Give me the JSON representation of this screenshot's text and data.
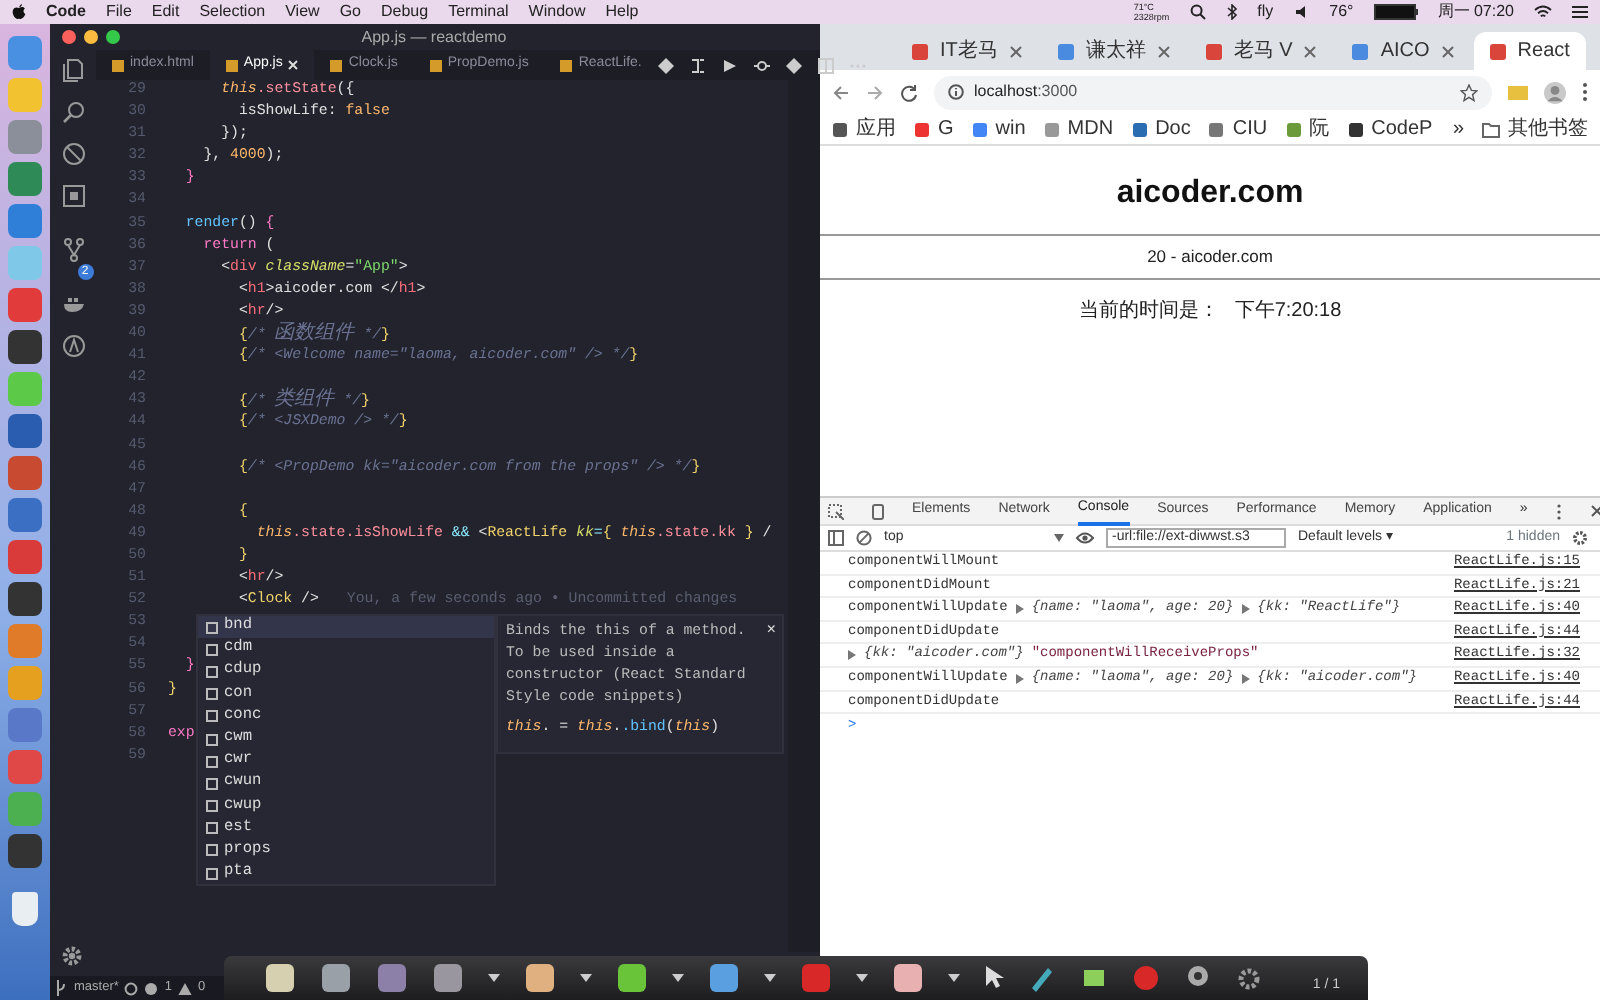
{
  "menubar": {
    "app": "Code",
    "items": [
      "File",
      "Edit",
      "Selection",
      "View",
      "Go",
      "Debug",
      "Terminal",
      "Window",
      "Help"
    ],
    "temp": "71°C",
    "fan": "2328rpm",
    "fly": "fly",
    "weather": "76°",
    "clock": "周一 07:20"
  },
  "editor": {
    "title": "App.js — reactdemo",
    "tabs": [
      {
        "label": "index.html",
        "selected": false
      },
      {
        "label": "App.js",
        "selected": true
      },
      {
        "label": "Clock.js",
        "selected": false
      },
      {
        "label": "PropDemo.js",
        "selected": false
      },
      {
        "label": "ReactLife.",
        "selected": false
      }
    ],
    "scm_badge": "2",
    "lines": [
      {
        "n": "29",
        "code": [
          {
            "kind": "this",
            "text": "      this"
          },
          {
            "kind": "prop",
            "text": ".setState"
          },
          {
            "kind": "pl",
            "text": "({"
          }
        ]
      },
      {
        "n": "30",
        "code": [
          {
            "kind": "pl",
            "text": "        isShowLife: "
          },
          {
            "kind": "num",
            "text": "false"
          }
        ]
      },
      {
        "n": "31",
        "code": [
          {
            "kind": "pl",
            "text": "      });"
          }
        ]
      },
      {
        "n": "32",
        "code": [
          {
            "kind": "pl",
            "text": "    }, "
          },
          {
            "kind": "num",
            "text": "4000"
          },
          {
            "kind": "pl",
            "text": ");"
          }
        ]
      },
      {
        "n": "33",
        "code": [
          {
            "kind": "kw",
            "text": "  }"
          }
        ]
      },
      {
        "n": "34"
      },
      {
        "n": "35",
        "code": [
          {
            "kind": "fn",
            "text": "  render"
          },
          {
            "kind": "pl",
            "text": "() "
          },
          {
            "kind": "kw",
            "text": "{"
          }
        ]
      },
      {
        "n": "36",
        "code": [
          {
            "kind": "kw",
            "text": "    return"
          },
          {
            "kind": "pl",
            "text": " ("
          }
        ]
      },
      {
        "n": "37",
        "code": [
          {
            "kind": "pl",
            "text": "      <"
          },
          {
            "kind": "tag",
            "text": "div"
          },
          {
            "kind": "attr",
            "text": " className"
          },
          {
            "kind": "pl",
            "text": "="
          },
          {
            "kind": "str",
            "text": "\"App\""
          },
          {
            "kind": "pl",
            "text": ">"
          }
        ]
      },
      {
        "n": "38",
        "code": [
          {
            "kind": "pl",
            "text": "        <"
          },
          {
            "kind": "tag",
            "text": "h1"
          },
          {
            "kind": "pl",
            "text": ">aicoder.com </"
          },
          {
            "kind": "tag",
            "text": "h1"
          },
          {
            "kind": "pl",
            "text": ">"
          }
        ]
      },
      {
        "n": "39",
        "code": [
          {
            "kind": "pl",
            "text": "        <"
          },
          {
            "kind": "tag",
            "text": "hr"
          },
          {
            "kind": "pl",
            "text": "/>"
          }
        ]
      },
      {
        "n": "40",
        "code": [
          {
            "kind": "brace",
            "text": "        {"
          },
          {
            "kind": "cmt",
            "text": "/* "
          },
          {
            "kind": "cmtcjk",
            "text": "函数组件"
          },
          {
            "kind": "cmt",
            "text": " */"
          },
          {
            "kind": "brace",
            "text": "}"
          }
        ]
      },
      {
        "n": "41",
        "code": [
          {
            "kind": "brace",
            "text": "        {"
          },
          {
            "kind": "cmt",
            "text": "/* <Welcome name=\"laoma, aicoder.com\" /> */"
          },
          {
            "kind": "brace",
            "text": "}"
          }
        ]
      },
      {
        "n": "42"
      },
      {
        "n": "43",
        "code": [
          {
            "kind": "brace",
            "text": "        {"
          },
          {
            "kind": "cmt",
            "text": "/* "
          },
          {
            "kind": "cmtcjk",
            "text": "类组件"
          },
          {
            "kind": "cmt",
            "text": " */"
          },
          {
            "kind": "brace",
            "text": "}"
          }
        ]
      },
      {
        "n": "44",
        "code": [
          {
            "kind": "brace",
            "text": "        {"
          },
          {
            "kind": "cmt",
            "text": "/* <JSXDemo /> */"
          },
          {
            "kind": "brace",
            "text": "}"
          }
        ]
      },
      {
        "n": "45"
      },
      {
        "n": "46",
        "code": [
          {
            "kind": "brace",
            "text": "        {"
          },
          {
            "kind": "cmt",
            "text": "/* <PropDemo kk=\"aicoder.com from the props\" /> */"
          },
          {
            "kind": "brace",
            "text": "}"
          }
        ]
      },
      {
        "n": "47"
      },
      {
        "n": "48",
        "code": [
          {
            "kind": "brace",
            "text": "        {"
          }
        ]
      },
      {
        "n": "49",
        "code": [
          {
            "kind": "this",
            "text": "          this"
          },
          {
            "kind": "prop",
            "text": ".state.isShowLife"
          },
          {
            "kind": "op",
            "text": " && "
          },
          {
            "kind": "pl",
            "text": "<"
          },
          {
            "kind": "comp",
            "text": "ReactLife"
          },
          {
            "kind": "attr",
            "text": " kk"
          },
          {
            "kind": "op",
            "text": "="
          },
          {
            "kind": "brace",
            "text": "{"
          },
          {
            "kind": "this",
            "text": " this"
          },
          {
            "kind": "prop",
            "text": ".state.kk"
          },
          {
            "kind": "brace",
            "text": " }"
          },
          {
            "kind": "pl",
            "text": " /"
          }
        ]
      },
      {
        "n": "50",
        "code": [
          {
            "kind": "brace",
            "text": "        }"
          }
        ]
      },
      {
        "n": "51",
        "code": [
          {
            "kind": "pl",
            "text": "        <"
          },
          {
            "kind": "tag",
            "text": "hr"
          },
          {
            "kind": "pl",
            "text": "/>"
          }
        ]
      },
      {
        "n": "52",
        "code": [
          {
            "kind": "pl",
            "text": "        <"
          },
          {
            "kind": "comp",
            "text": "Clock"
          },
          {
            "kind": "pl",
            "text": " />"
          }
        ],
        "blame": "You, a few seconds ago • Uncommitted changes"
      },
      {
        "n": "53"
      },
      {
        "n": "54"
      },
      {
        "n": "55",
        "code": [
          {
            "kind": "kw",
            "text": "  }"
          }
        ]
      },
      {
        "n": "56",
        "code": [
          {
            "kind": "brace",
            "text": "}"
          }
        ]
      },
      {
        "n": "57"
      },
      {
        "n": "58",
        "code": [
          {
            "kind": "kw",
            "text": "exp"
          }
        ]
      },
      {
        "n": "59"
      }
    ],
    "suggest": [
      {
        "label": "bnd",
        "selected": true
      },
      {
        "label": "cdm",
        "selected": false
      },
      {
        "label": "cdup",
        "selected": false
      },
      {
        "label": "con",
        "selected": false
      },
      {
        "label": "conc",
        "selected": false
      },
      {
        "label": "cwm",
        "selected": false
      },
      {
        "label": "cwr",
        "selected": false
      },
      {
        "label": "cwun",
        "selected": false
      },
      {
        "label": "cwup",
        "selected": false
      },
      {
        "label": "est",
        "selected": false
      },
      {
        "label": "props",
        "selected": false
      },
      {
        "label": "pta",
        "selected": false
      }
    ],
    "doc": {
      "text": "Binds the this of a method. To be used inside a constructor (React Standard Style code snippets)",
      "close": "×",
      "code": [
        {
          "kind": "this",
          "text": "this"
        },
        {
          "kind": "pl",
          "text": ". = "
        },
        {
          "kind": "this",
          "text": "this"
        },
        {
          "kind": "pl",
          "text": "."
        },
        {
          "kind": "fn",
          "text": ".bind"
        },
        {
          "kind": "pl",
          "text": "("
        },
        {
          "kind": "this",
          "text": "this"
        },
        {
          "kind": "pl",
          "text": ")"
        }
      ]
    },
    "status": {
      "branch": "master*",
      "errors": "1",
      "warnings": "0"
    }
  },
  "recorder": {
    "page": "1 / 1"
  },
  "browser": {
    "tabs": [
      {
        "label": "IT老马",
        "selected": false
      },
      {
        "label": "谦太祥",
        "selected": false
      },
      {
        "label": "老马 V",
        "selected": false
      },
      {
        "label": "AICO",
        "selected": false
      },
      {
        "label": "React",
        "selected": true
      }
    ],
    "url": "**localhost**:3000",
    "bookmarks": [
      "应用",
      "G",
      "win",
      "MDN",
      "Doc",
      "CIU",
      "阮",
      "CodeP"
    ],
    "bookmarks_more": "»",
    "other_bookmarks": "其他书签",
    "page": {
      "heading": "aicoder.com",
      "props": "20 - aicoder.com",
      "time_label": "当前的时间是：",
      "time": "下午7:20:18"
    }
  },
  "devtools": {
    "tabs": [
      {
        "label": "Elements",
        "selected": false
      },
      {
        "label": "Network",
        "selected": false
      },
      {
        "label": "Console",
        "selected": true
      },
      {
        "label": "Sources",
        "selected": false
      },
      {
        "label": "Performance",
        "selected": false
      },
      {
        "label": "Memory",
        "selected": false
      },
      {
        "label": "Application",
        "selected": false
      }
    ],
    "more": "»",
    "context": "top",
    "filter": "-url:file://ext-diwwst.s3",
    "levels": "Default levels ▾",
    "hidden": "1 hidden",
    "rows": [
      {
        "parts": [
          {
            "kind": "text",
            "text": "componentWillMount"
          }
        ],
        "source": "ReactLife.js:15"
      },
      {
        "parts": [
          {
            "kind": "text",
            "text": "componentDidMount"
          }
        ],
        "source": "ReactLife.js:21"
      },
      {
        "parts": [
          {
            "kind": "text",
            "text": "componentWillUpdate"
          },
          {
            "kind": "object",
            "text": "{name: \"laoma\", age: 20}"
          },
          {
            "kind": "object",
            "text": "{kk: \"ReactLife\"}"
          }
        ],
        "source": "ReactLife.js:40"
      },
      {
        "parts": [
          {
            "kind": "text",
            "text": "componentDidUpdate"
          }
        ],
        "source": "ReactLife.js:44"
      },
      {
        "parts": [
          {
            "kind": "object",
            "text": "{kk: \"aicoder.com\"}"
          },
          {
            "kind": "string",
            "text": "\"componentWillReceiveProps\""
          }
        ],
        "source": "ReactLife.js:32"
      },
      {
        "parts": [
          {
            "kind": "text",
            "text": "componentWillUpdate"
          },
          {
            "kind": "object",
            "text": "{name: \"laoma\", age: 20}"
          },
          {
            "kind": "object",
            "text": "{kk: \"aicoder.com\"}"
          }
        ],
        "source": "ReactLife.js:40"
      },
      {
        "parts": [
          {
            "kind": "text",
            "text": "componentDidUpdate"
          }
        ],
        "source": "ReactLife.js:44"
      }
    ],
    "prompt": ">"
  }
}
